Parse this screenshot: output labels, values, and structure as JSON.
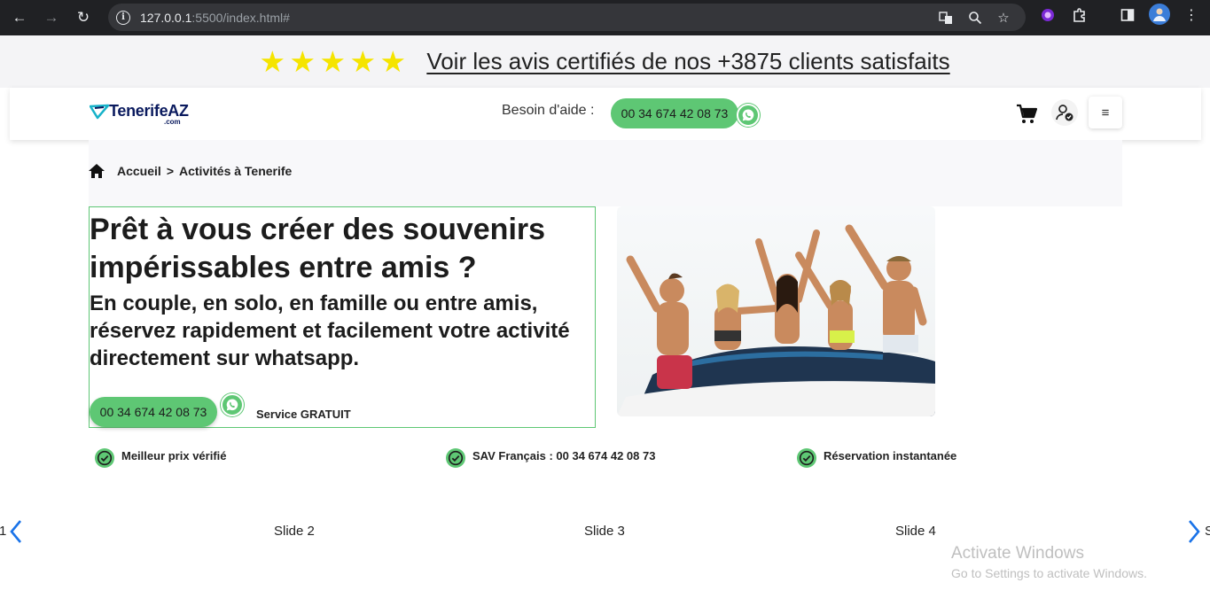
{
  "browser": {
    "url_host": "127.0.0.1",
    "url_rest": ":5500/index.html#"
  },
  "review_banner": {
    "star_count": 5,
    "link_text": "Voir les avis certifiés de nos +3875 clients satisfaits",
    "star_color": "#f5e400"
  },
  "header": {
    "logo_name": "TenerifeAZ",
    "logo_suffix": ".com",
    "help_label": "Besoin d'aide :",
    "phone": "00 34 674 42 08 73"
  },
  "breadcrumb": {
    "home": "Accueil",
    "separator": ">",
    "current": "Activités à Tenerife"
  },
  "hero": {
    "title": "Prêt à vous créer des souvenirs impérissables entre amis ?",
    "subtitle": "En couple, en solo, en famille ou entre amis, réservez rapidement et facilement votre activité directement sur whatsapp.",
    "phone": "00 34 674 42 08 73",
    "free_label": "Service GRATUIT"
  },
  "features": [
    {
      "label": "Meilleur prix vérifié"
    },
    {
      "label": "SAV Français : 00 34 674 42 08 73"
    },
    {
      "label": "Réservation instantanée"
    }
  ],
  "slider": {
    "left_partial": "1",
    "slides": [
      "Slide 2",
      "Slide 3",
      "Slide 4"
    ],
    "right_partial": "S"
  },
  "watermark": {
    "title": "Activate Windows",
    "subtitle": "Go to Settings to activate Windows."
  },
  "colors": {
    "accent_green": "#5ec774",
    "brand_navy": "#0a1a5e",
    "arrow_blue": "#1a73e8"
  }
}
